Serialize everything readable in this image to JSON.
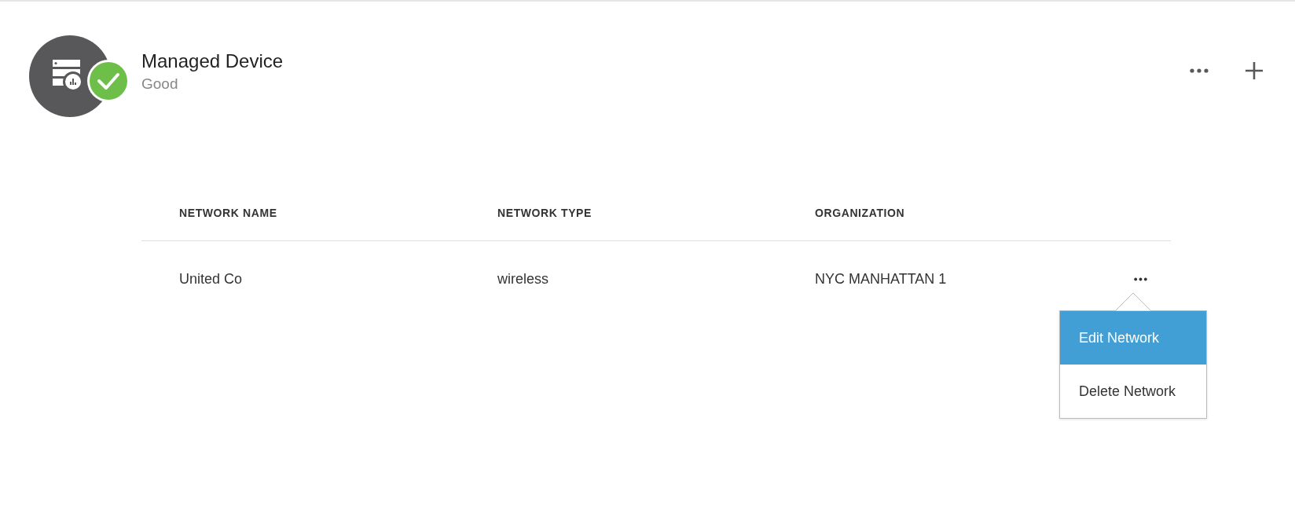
{
  "device": {
    "name": "Managed Device",
    "status": "Good",
    "healthy": true
  },
  "table": {
    "columns": [
      "NETWORK NAME",
      "NETWORK TYPE",
      "ORGANIZATION"
    ],
    "rows": [
      {
        "cells": [
          "United Co",
          "wireless",
          "NYC MANHATTAN 1"
        ],
        "menu_open": true
      }
    ]
  },
  "row_menu": {
    "items": [
      {
        "label": "Edit Network",
        "selected": true
      },
      {
        "label": "Delete Network",
        "selected": false
      }
    ]
  }
}
